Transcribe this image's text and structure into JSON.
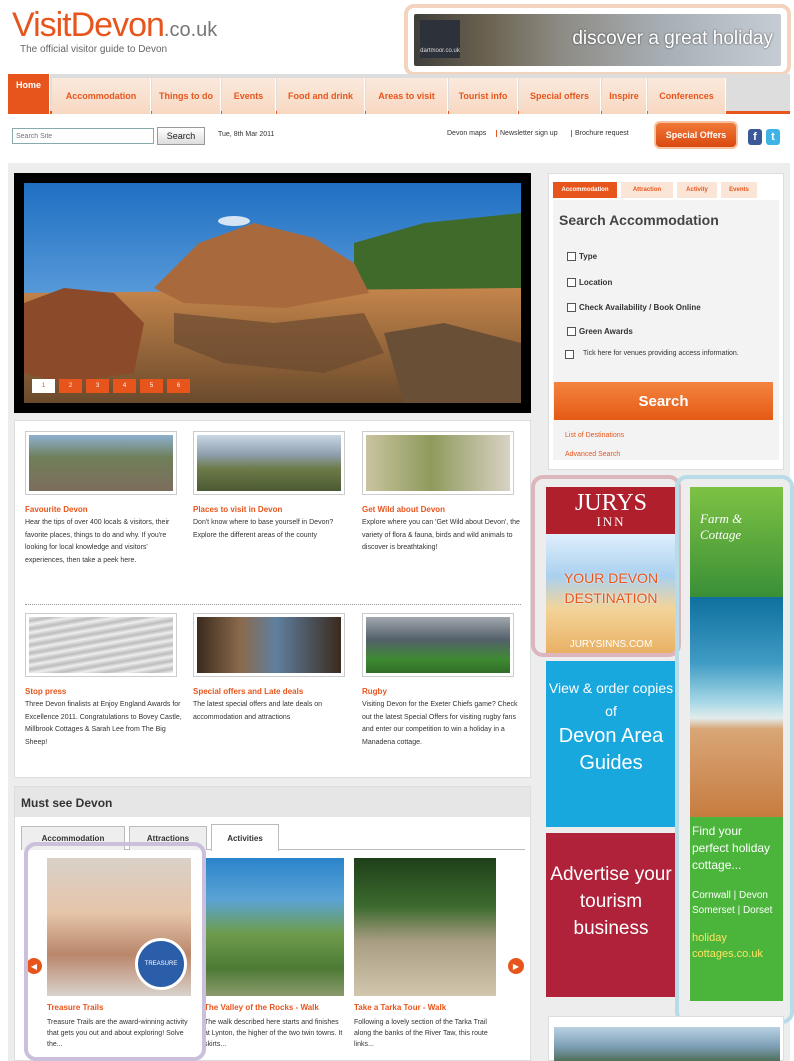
{
  "header": {
    "brand_main": "VisitDevon",
    "brand_tld": ".co.uk",
    "tagline": "The official visitor guide to Devon",
    "banner_logo": "dartmoor.co.uk",
    "banner_text": "discover a great holiday"
  },
  "nav": {
    "tabs": [
      {
        "label": "Home"
      },
      {
        "label": "Accommodation"
      },
      {
        "label": "Things to do"
      },
      {
        "label": "Events"
      },
      {
        "label": "Food and drink"
      },
      {
        "label": "Areas to visit"
      },
      {
        "label": "Tourist info"
      },
      {
        "label": "Special offers"
      },
      {
        "label": "Inspire"
      },
      {
        "label": "Conferences"
      }
    ]
  },
  "utility": {
    "search_placeholder": "Search Site",
    "search_button": "Search",
    "date": "Tue, 8th Mar 2011",
    "links": [
      "Devon maps",
      "Newsletter sign up",
      "Brochure request"
    ],
    "special_offers": "Special Offers",
    "facebook_icon": "f",
    "twitter_icon": "t"
  },
  "slideshow": {
    "pages": [
      "1",
      "2",
      "3",
      "4",
      "5",
      "6"
    ]
  },
  "cards": [
    {
      "title": "Favourite Devon",
      "desc": "Hear the tips of over 400 locals & visitors, their favorite places, things to do and why. If you're looking for local knowledge and visitors' experiences, then take a peek here."
    },
    {
      "title": "Places to visit in Devon",
      "desc": "Don't know where to base yourself in Devon? Explore the different areas of the county"
    },
    {
      "title": "Get Wild about Devon",
      "desc": "Explore where you can 'Get Wild about Devon', the variety of flora & fauna, birds and wild animals to discover is breathtaking!"
    },
    {
      "title": "Stop press",
      "desc": "Three Devon finalists at Enjoy England Awards for Excellence 2011. Congratulations to Bovey Castle, Millbrook Cottages & Sarah Lee from The Big Sheep!"
    },
    {
      "title": "Special offers and Late deals",
      "desc": "The latest special offers and late deals on accommodation and attractions"
    },
    {
      "title": "Rugby",
      "desc": "Visiting Devon for the Exeter Chiefs game? Check out the latest Special Offers for visiting rugby fans and enter our competition to win a holiday in a Manadena cottage."
    }
  ],
  "mustsee": {
    "heading": "Must see Devon",
    "tabs": [
      "Accommodation",
      "Attractions",
      "Activities"
    ],
    "items": [
      {
        "title": "Treasure Trails",
        "desc": "Treasure Trails are the award-winning activity that gets you out and about exploring! Solve the..."
      },
      {
        "title": "The Valley of the Rocks - Walk",
        "desc": "The walk described here starts and finishes at Lynton, the higher of the two twin towns. It skirts..."
      },
      {
        "title": "Take a Tarka Tour - Walk",
        "desc": "Following a lovely section of the Tarka Trail along the banks of the River Taw, this route links..."
      }
    ],
    "treasure_badge": "TREASURE"
  },
  "search_panel": {
    "tabs": [
      "Accommodation",
      "Attraction",
      "Activity",
      "Events"
    ],
    "heading": "Search Accommodation",
    "options": [
      "Type",
      "Location",
      "Check Availability / Book Online",
      "Green Awards"
    ],
    "access_option": "Tick here for venues providing access information.",
    "button": "Search",
    "links": [
      "List of Destinations",
      "Advanced Search"
    ]
  },
  "ads": {
    "jurys_a": "JURYS",
    "jurys_b": "INN",
    "jurys_tagline": "YOUR DEVON DESTINATION",
    "jurys_url": "JURYSINNS.COM",
    "guides_line1": "View & order copies of",
    "guides_line2": "Devon Area Guides",
    "advertise": "Advertise your tourism business",
    "farm_logo": "Farm & Cottage",
    "farm_text": "Find your perfect holiday cottage...",
    "farm_regions": "Cornwall | Devon Somerset | Dorset",
    "farm_url": "holiday cottages.co.uk"
  },
  "colors": {
    "accent": "#e8551c",
    "jurys_red": "#b01f2c",
    "guides_blue": "#19a8de",
    "farm_green": "#4bb53b"
  }
}
